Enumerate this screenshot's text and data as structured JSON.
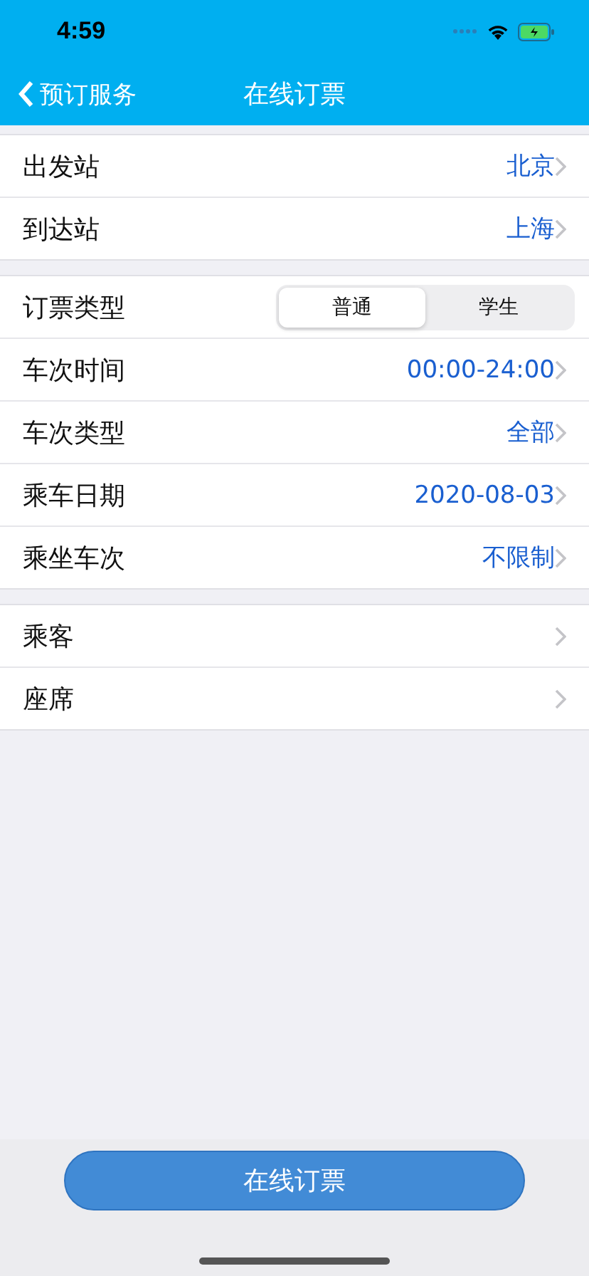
{
  "status_bar": {
    "time": "4:59"
  },
  "nav": {
    "back": "预订服务",
    "title": "在线订票"
  },
  "sections": [
    {
      "rows": [
        {
          "kind": "value",
          "label": "出发站",
          "value": "北京"
        },
        {
          "kind": "value",
          "label": "到达站",
          "value": "上海"
        }
      ]
    },
    {
      "rows": [
        {
          "kind": "segment",
          "label": "订票类型",
          "options": [
            {
              "label": "普通",
              "selected": true
            },
            {
              "label": "学生",
              "selected": false
            }
          ]
        },
        {
          "kind": "value",
          "label": "车次时间",
          "value": "00:00-24:00"
        },
        {
          "kind": "value",
          "label": "车次类型",
          "value": "全部"
        },
        {
          "kind": "value",
          "label": "乘车日期",
          "value": "2020-08-03"
        },
        {
          "kind": "value",
          "label": "乘坐车次",
          "value": "不限制"
        }
      ]
    },
    {
      "rows": [
        {
          "kind": "value",
          "label": "乘客"
        },
        {
          "kind": "value",
          "label": "座席"
        }
      ]
    }
  ],
  "submit_button": "在线订票"
}
